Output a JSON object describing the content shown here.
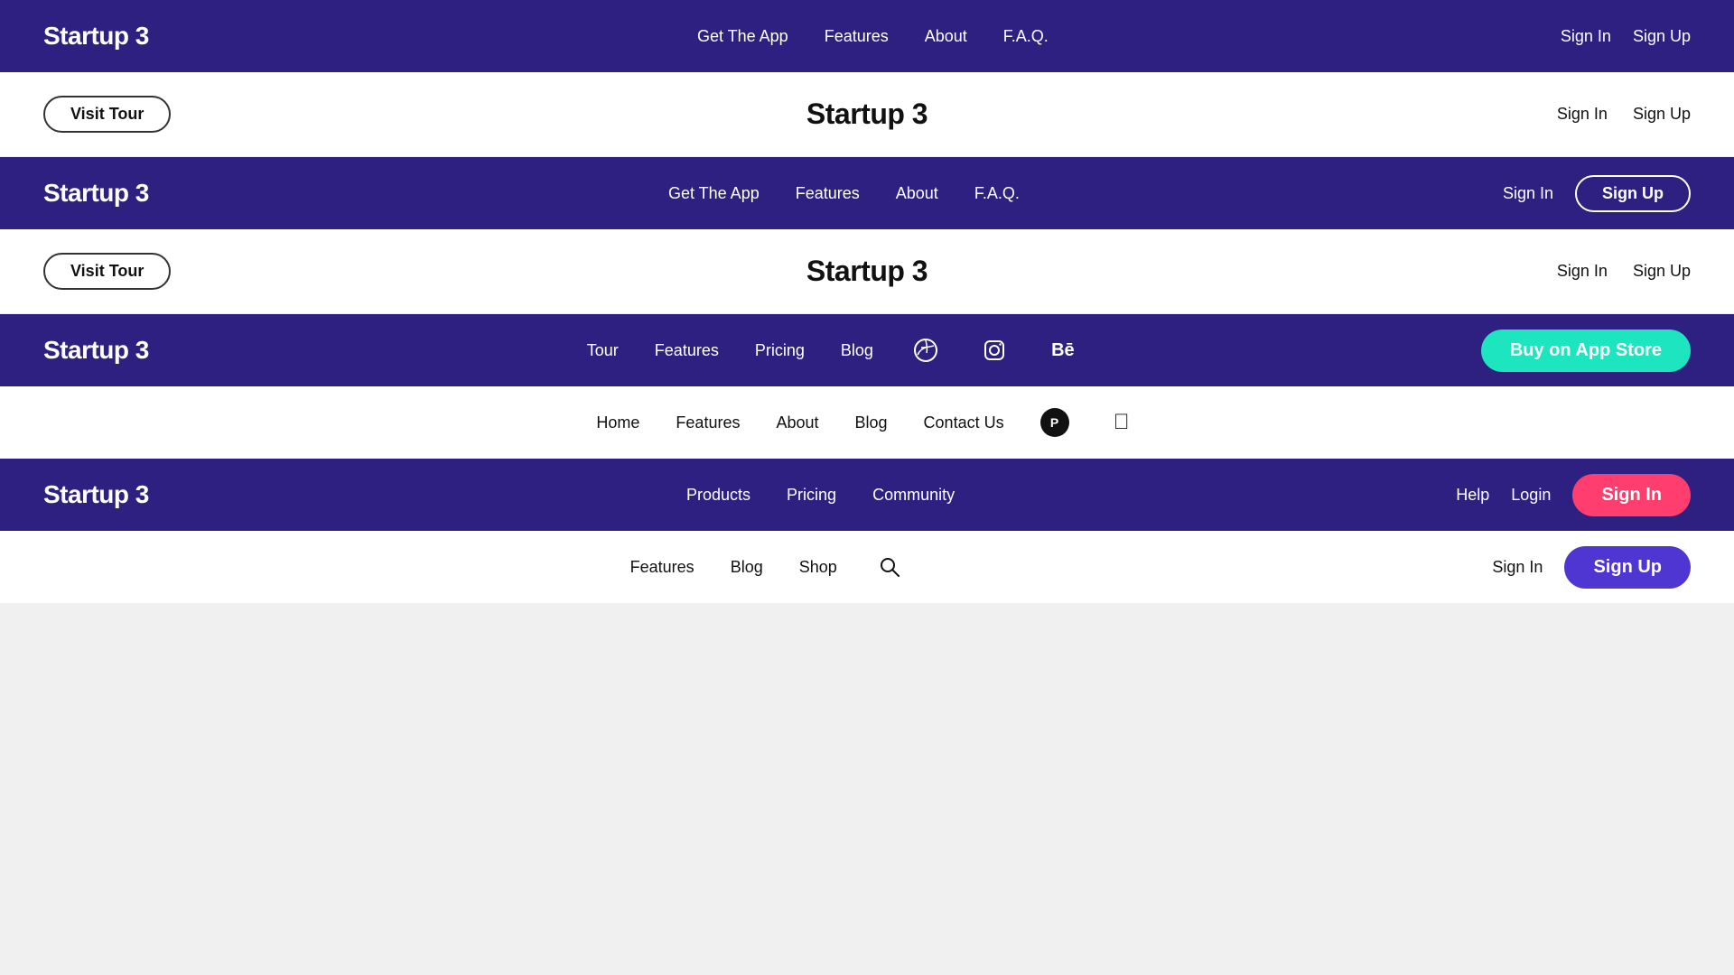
{
  "navbars": [
    {
      "id": "nav1",
      "theme": "dark",
      "brand": "Startup 3",
      "links": [
        "Get The App",
        "Features",
        "About",
        "F.A.Q."
      ],
      "right": {
        "type": "signin-signup-text",
        "signin": "Sign In",
        "signup": "Sign Up"
      }
    },
    {
      "id": "sub1",
      "theme": "light",
      "type": "sub-header",
      "brand": "Startup 3",
      "left_btn": "Visit Tour",
      "right": {
        "signin": "Sign In",
        "signup": "Sign Up"
      }
    },
    {
      "id": "nav2",
      "theme": "dark",
      "brand": "Startup 3",
      "links": [
        "Get The App",
        "Features",
        "About",
        "F.A.Q."
      ],
      "right": {
        "type": "signin-signup-btn",
        "signin": "Sign In",
        "signup": "Sign Up"
      }
    },
    {
      "id": "sub2",
      "theme": "light",
      "type": "sub-header",
      "brand": "Startup 3",
      "left_btn": "Visit Tour",
      "right": {
        "signin": "Sign In",
        "signup": "Sign Up"
      }
    },
    {
      "id": "nav3",
      "theme": "dark",
      "brand": "Startup 3",
      "links": [
        "Tour",
        "Features",
        "Pricing",
        "Blog"
      ],
      "socials": [
        "dribbble",
        "instagram",
        "behance"
      ],
      "right": {
        "type": "buy-app-store",
        "label": "Buy on App Store"
      }
    },
    {
      "id": "nav4",
      "theme": "light",
      "brand": "",
      "links": [
        "Home",
        "Features",
        "About",
        "Blog",
        "Contact Us"
      ],
      "socials": [
        "producthunt",
        "apple"
      ],
      "right": {}
    },
    {
      "id": "nav5",
      "theme": "dark",
      "brand": "Startup 3",
      "links": [
        "Products",
        "Pricing",
        "Community"
      ],
      "right": {
        "type": "help-login-signin",
        "help": "Help",
        "login": "Login",
        "signin": "Sign In"
      }
    },
    {
      "id": "nav6",
      "theme": "light",
      "brand": "",
      "links": [
        "Features",
        "Blog",
        "Shop"
      ],
      "socials": [
        "search"
      ],
      "right": {
        "type": "signin-signup-btn",
        "signin": "Sign In",
        "signup": "Sign Up"
      }
    }
  ],
  "colors": {
    "dark_bg": "#2d2080",
    "light_bg": "#ffffff",
    "teal": "#1de5c0",
    "pink": "#ff3d6e",
    "purple": "#4f35d2"
  }
}
